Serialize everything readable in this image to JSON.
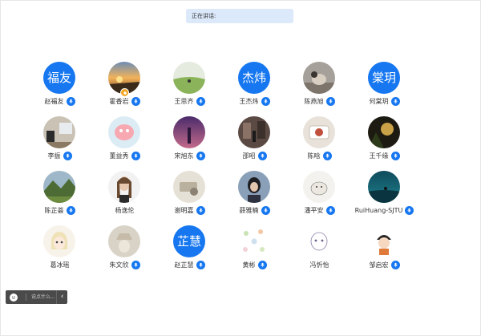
{
  "status": {
    "speaking_label": "正在讲话:"
  },
  "participants": [
    {
      "name": "赵福友",
      "avatar_text": "福友"
    },
    {
      "name": "霍香岩",
      "avatar_photo": "sunset-photo"
    },
    {
      "name": "王思齐",
      "avatar_photo": "grassland-photo"
    },
    {
      "name": "王杰炜",
      "avatar_text": "杰炜"
    },
    {
      "name": "陈燕旭",
      "avatar_photo": "dog-photo"
    },
    {
      "name": "何棠玥",
      "avatar_text": "棠玥"
    },
    {
      "name": "李振",
      "avatar_photo": "classroom-photo"
    },
    {
      "name": "董益秀",
      "avatar_photo": "cartoon-photo"
    },
    {
      "name": "宋旭东",
      "avatar_photo": "purple-night-photo"
    },
    {
      "name": "邵昭",
      "avatar_photo": "street-photo"
    },
    {
      "name": "陈晗",
      "avatar_photo": "plate-photo"
    },
    {
      "name": "王千缘",
      "avatar_photo": "dark-forest-photo"
    },
    {
      "name": "陈芷荟",
      "avatar_photo": "mountain-photo"
    },
    {
      "name": "杨逸伦",
      "avatar_photo": "woman-portrait-photo"
    },
    {
      "name": "谢明嘉",
      "avatar_photo": "sketch-photo"
    },
    {
      "name": "薛雅楠",
      "avatar_photo": "girl-photo"
    },
    {
      "name": "潘平安",
      "avatar_photo": "cat-drawing-photo"
    },
    {
      "name": "RuiHuang-SJTU",
      "avatar_photo": "sea-photo"
    },
    {
      "name": "葛冰瑶",
      "avatar_photo": "anime-girl-photo"
    },
    {
      "name": "朱文欣",
      "avatar_photo": "hat-drawing-photo"
    },
    {
      "name": "赵芷慧",
      "avatar_text": "芷慧"
    },
    {
      "name": "黄彬",
      "avatar_photo": "pattern-photo"
    },
    {
      "name": "冯忻怡",
      "avatar_photo": "line-drawing-photo"
    },
    {
      "name": "邹启宏",
      "avatar_photo": "boy-cartoon-photo"
    }
  ],
  "chat": {
    "placeholder": "说点什么...",
    "collapse_icon": "chevron-left-icon",
    "emoji_icon": "smile-icon"
  },
  "colors": {
    "accent": "#1677f0",
    "speaking_bg": "#dbe9fb",
    "chatbar_bg": "#4a4a4a"
  }
}
